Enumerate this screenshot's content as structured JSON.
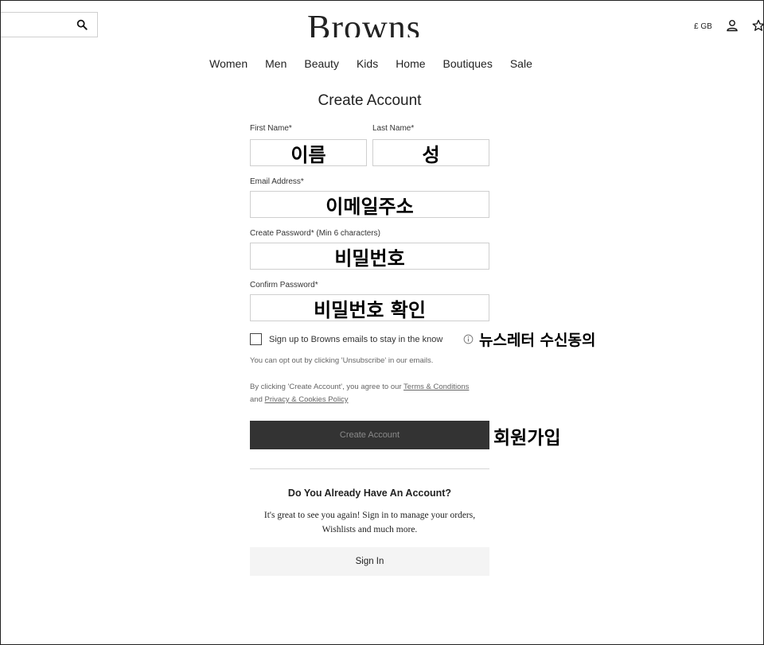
{
  "header": {
    "logo_text": "Browns",
    "region": "£ GB",
    "icons": [
      "search-icon",
      "account-icon",
      "wishlist-star-icon"
    ]
  },
  "nav": {
    "items": [
      "Women",
      "Men",
      "Beauty",
      "Kids",
      "Home",
      "Boutiques",
      "Sale"
    ]
  },
  "form": {
    "title": "Create Account",
    "first_name_label": "First Name*",
    "last_name_label": "Last Name*",
    "email_label": "Email Address*",
    "password_label": "Create Password* (Min 6 characters)",
    "confirm_label": "Confirm Password*",
    "first_name_value": "이름",
    "last_name_value": "성",
    "email_value": "이메일주소",
    "password_value": "비밀번호",
    "confirm_value": "비밀번호 확인",
    "newsletter_label": "Sign up to Browns emails to stay in the know",
    "opt_out_text": "You can opt out by clicking 'Unsubscribe' in our emails.",
    "agree_prefix": "By clicking 'Create Account', you agree to our ",
    "terms_link": "Terms & Conditions",
    "and_text": "and ",
    "privacy_link": "Privacy & Cookies Policy",
    "create_button": "Create Account"
  },
  "existing": {
    "heading": "Do You Already Have An Account?",
    "desc_line1": "It's great to see you again! Sign in to manage your orders,",
    "desc_line2": "Wishlists and much more.",
    "signin_button": "Sign In"
  },
  "annotations": {
    "newsletter": "뉴스레터 수신동의",
    "signup": "회원가입"
  },
  "colors": {
    "button_dark": "#333333",
    "button_light": "#f4f4f4",
    "border": "#cfcfcf"
  }
}
